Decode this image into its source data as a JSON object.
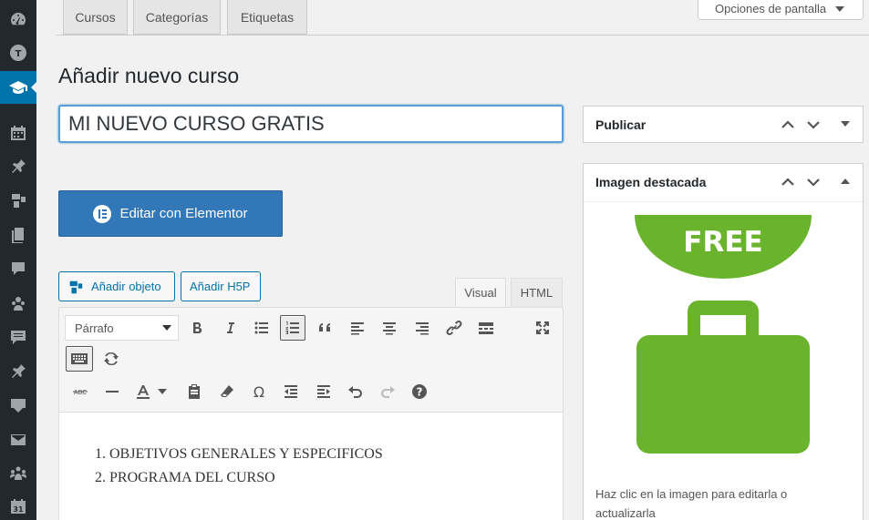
{
  "sidebar": {
    "items": [
      {
        "icon": "dashboard-icon"
      },
      {
        "icon": "tutor-icon"
      },
      {
        "icon": "graduation-cap-icon",
        "active": true
      },
      {
        "icon": "calendar-icon"
      },
      {
        "icon": "pin-icon"
      },
      {
        "icon": "media-icon"
      },
      {
        "icon": "pages-icon"
      },
      {
        "icon": "comments-icon"
      },
      {
        "icon": "users-group-icon"
      },
      {
        "icon": "feedback-icon"
      },
      {
        "icon": "pin-icon"
      },
      {
        "icon": "download-icon"
      },
      {
        "icon": "mail-icon"
      },
      {
        "icon": "community-icon"
      },
      {
        "icon": "calendar-31-icon"
      }
    ]
  },
  "tabs": [
    "Cursos",
    "Categorías",
    "Etiquetas"
  ],
  "screen_options": "Opciones de pantalla",
  "page": {
    "title": "Añadir nuevo curso",
    "post_title_value": "MI NUEVO CURSO GRATIS"
  },
  "elementor_button": "Editar con Elementor",
  "media_buttons": {
    "add_object": "Añadir objeto",
    "add_h5p": "Añadir H5P"
  },
  "editor": {
    "tab_visual": "Visual",
    "tab_html": "HTML",
    "format_select": "Párrafo",
    "content_items": [
      "OBJETIVOS GENERALES Y ESPECIFICOS",
      "PROGRAMA DEL CURSO"
    ]
  },
  "publish_box": {
    "title": "Publicar"
  },
  "featured_box": {
    "title": "Imagen destacada",
    "image_text": "FREE",
    "caption": "Haz clic en la imagen para editarla o actualizarla"
  },
  "colors": {
    "accent": "#0073aa",
    "elementor": "#3277b7",
    "featured_green": "#6ab42d",
    "sidebar_bg": "#23282d"
  }
}
